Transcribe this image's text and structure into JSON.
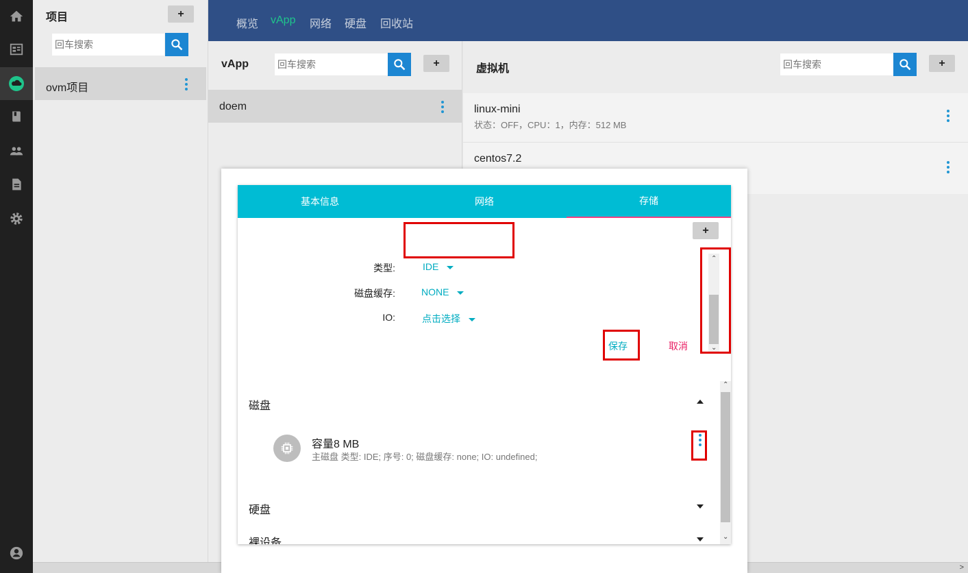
{
  "nav": {
    "tabs": [
      "概览",
      "vApp",
      "网络",
      "硬盘",
      "回收站"
    ]
  },
  "projects": {
    "title": "项目",
    "add_label": "+",
    "search_placeholder": "回车搜索",
    "items": [
      {
        "name": "ovm项目"
      }
    ]
  },
  "vapp": {
    "title": "vApp",
    "add_label": "+",
    "search_placeholder": "回车搜索",
    "items": [
      {
        "name": "doem"
      }
    ]
  },
  "vms": {
    "title": "虚拟机",
    "add_label": "+",
    "search_placeholder": "回车搜索",
    "items": [
      {
        "name": "linux-mini",
        "detail": "状态：OFF，CPU：1，内存：512 MB"
      },
      {
        "name": "centos7.2",
        "detail": ""
      }
    ]
  },
  "modal": {
    "tabs": [
      "基本信息",
      "网络",
      "存储"
    ],
    "add_label": "+",
    "form": {
      "type_label": "类型:",
      "type_value": "IDE",
      "cache_label": "磁盘缓存:",
      "cache_value": "NONE",
      "io_label": "IO:",
      "io_value": "点击选择",
      "save_label": "保存",
      "cancel_label": "取消"
    },
    "sections": {
      "disk_title": "磁盘",
      "disk_item": {
        "title": "容量8 MB",
        "detail": "主磁盘 类型: IDE; 序号: 0; 磁盘缓存: none; IO: undefined;"
      },
      "hdd_title": "硬盘",
      "raw_title": "裸设备"
    }
  },
  "colors": {
    "topbar": "#2f4f86",
    "active_nav": "#1fc48b",
    "tab_bar": "#00bcd4",
    "accent": "#00acc1",
    "cancel": "#e91e63",
    "search_button": "#1c86d2",
    "highlight": "#e00000"
  }
}
